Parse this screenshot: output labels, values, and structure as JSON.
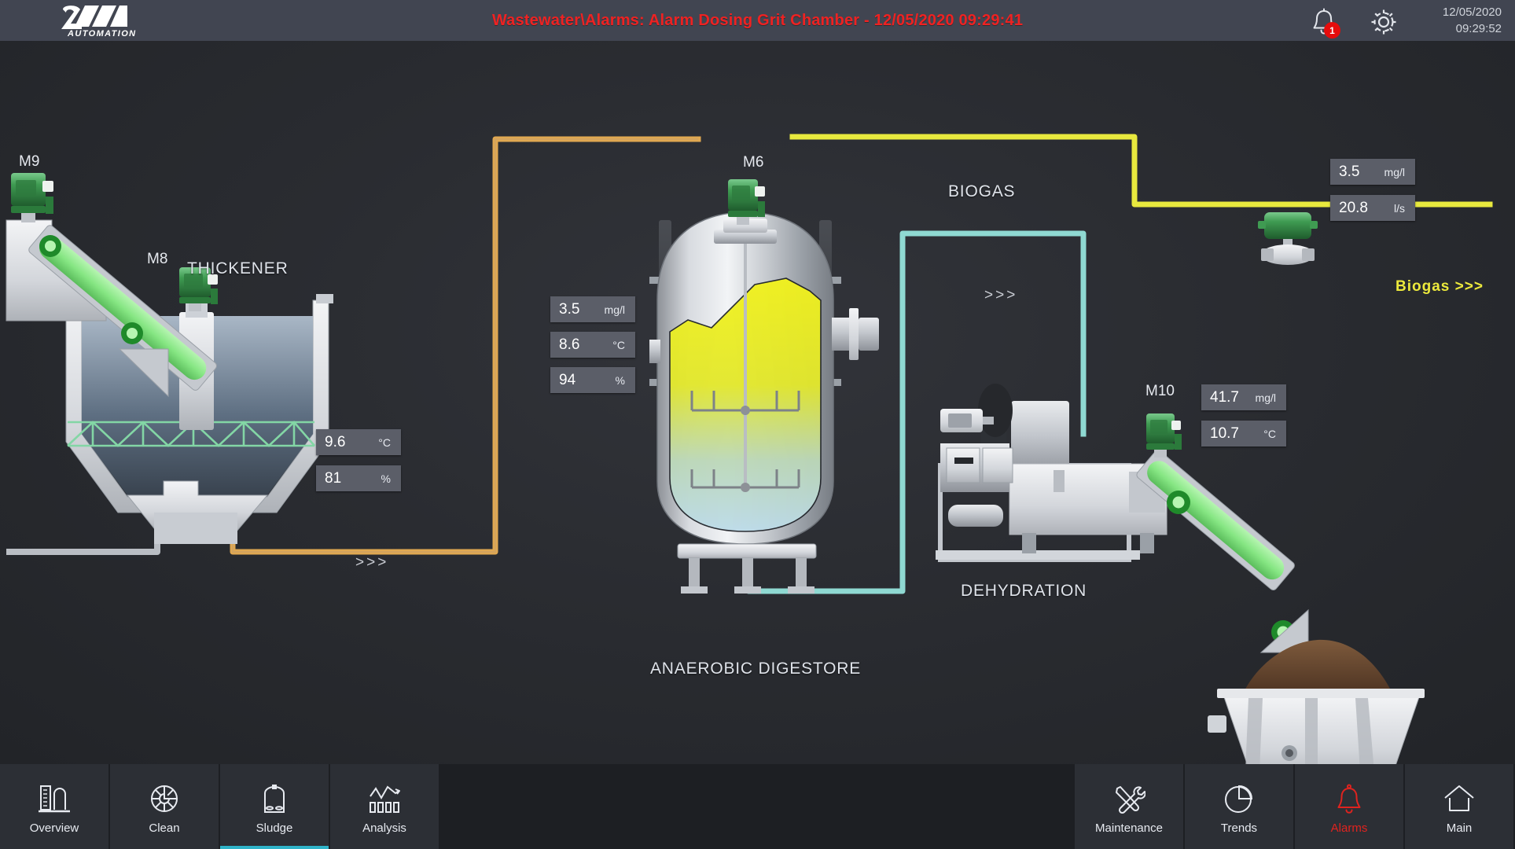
{
  "header": {
    "title": "Wastewater\\Alarms: Alarm Dosing Grit Chamber - 12/05/2020 09:29:41",
    "logo_text": "AUTOMATION",
    "logo_mark": "2M",
    "alarm_badge": "1",
    "bell_icon": "bell-icon",
    "gear_icon": "gear-icon",
    "date": "12/05/2020",
    "time": "09:29:52"
  },
  "plant": {
    "labels": {
      "thickener": "THICKENER",
      "anaerobic_digestore": "ANAEROBIC DIGESTORE",
      "dehydration": "DEHYDRATION",
      "biogas": "BIOGAS",
      "biogas_out": "Biogas >>>"
    },
    "motors": {
      "m9": "M9",
      "m8": "M8",
      "m6": "M6",
      "m10": "M10"
    },
    "flow_arrows": {
      "sludge_line": ">>>",
      "digester_out": ">>>"
    },
    "readouts": {
      "thickener": [
        {
          "value": "9.6",
          "unit": "°C"
        },
        {
          "value": "81",
          "unit": "%"
        }
      ],
      "digester": [
        {
          "value": "3.5",
          "unit": "mg/l"
        },
        {
          "value": "8.6",
          "unit": "°C"
        },
        {
          "value": "94",
          "unit": "%"
        }
      ],
      "biogas": [
        {
          "value": "3.5",
          "unit": "mg/l"
        },
        {
          "value": "20.8",
          "unit": "l/s"
        }
      ],
      "dehydration": [
        {
          "value": "41.7",
          "unit": "mg/l"
        },
        {
          "value": "10.7",
          "unit": "°C"
        }
      ]
    },
    "colors": {
      "sludge_pipe": "#e0a851",
      "biogas_pipe": "#e8e93e",
      "recirc_pipe": "#8fd9d2",
      "motor_green": "#3f9b52",
      "belt_green": "#7ee07e",
      "digester_liquid_top": "#ecec18",
      "digester_liquid_bottom": "#bcd9e6",
      "alarm_red": "#e0231f",
      "accent_cyan": "#2fb3c8"
    }
  },
  "nav": {
    "left": [
      {
        "label": "Overview",
        "icon": "tank-gauge-icon",
        "active": false
      },
      {
        "label": "Clean",
        "icon": "impeller-icon",
        "active": false
      },
      {
        "label": "Sludge",
        "icon": "silo-icon",
        "active": true
      },
      {
        "label": "Analysis",
        "icon": "chart-bars-icon",
        "active": false
      }
    ],
    "right": [
      {
        "label": "Maintenance",
        "icon": "tools-icon",
        "active": false
      },
      {
        "label": "Trends",
        "icon": "pie-chart-icon",
        "active": false
      },
      {
        "label": "Alarms",
        "icon": "bell-icon",
        "active": false,
        "alarm": true
      },
      {
        "label": "Main",
        "icon": "home-icon",
        "active": false
      }
    ]
  }
}
